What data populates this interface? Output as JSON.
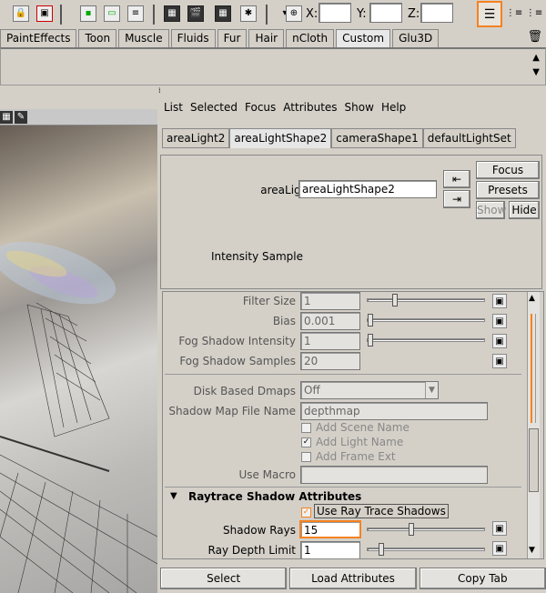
{
  "toolbar": {
    "x_label": "X:",
    "y_label": "Y:",
    "z_label": "Z:",
    "x_value": "",
    "y_value": "",
    "z_value": "",
    "icons": [
      "lock-icon",
      "select-object-icon",
      "snap-icon",
      "render-region-icon",
      "render-icon",
      "render-settings-icon",
      "clapper-icon",
      "ipr-icon",
      "render-view-icon",
      "dropdown-icon",
      "transform-icon",
      "attribute-editor-icon",
      "channel-box-icon",
      "tool-settings-icon"
    ]
  },
  "shelf": {
    "tabs": [
      "PaintEffects",
      "Toon",
      "Muscle",
      "Fluids",
      "Fur",
      "Hair",
      "nCloth",
      "Custom",
      "Glu3D"
    ],
    "active": "Custom"
  },
  "attr_editor": {
    "menu": [
      "List",
      "Selected",
      "Focus",
      "Attributes",
      "Show",
      "Help"
    ],
    "tabs": [
      "areaLight2",
      "areaLightShape2",
      "cameraShape1",
      "defaultLightSet"
    ],
    "active_tab": "areaLightShape2",
    "node_label": "areaLight:",
    "node_value": "areaLightShape2",
    "focus_btn": "Focus",
    "presets_btn": "Presets",
    "show_btn": "Show",
    "hide_btn": "Hide",
    "intensity_sample": "Intensity Sample"
  },
  "attributes": {
    "filter_size_label": "Filter Size",
    "filter_size_value": "1",
    "filter_size_level": 0.22,
    "bias_label": "Bias",
    "bias_value": "0.001",
    "bias_level": 0.0,
    "fog_intensity_label": "Fog Shadow Intensity",
    "fog_intensity_value": "1",
    "fog_intensity_level": 0.0,
    "fog_samples_label": "Fog Shadow Samples",
    "fog_samples_value": "20",
    "disk_dmaps_label": "Disk Based Dmaps",
    "disk_dmaps_value": "Off",
    "shadow_map_label": "Shadow Map File Name",
    "shadow_map_value": "depthmap",
    "add_scene_name": "Add Scene Name",
    "add_light_name": "Add Light Name",
    "add_frame_ext": "Add Frame Ext",
    "use_macro_label": "Use Macro",
    "use_macro_value": "",
    "raytrace_section": "Raytrace Shadow Attributes",
    "use_ray_trace": "Use Ray Trace Shadows",
    "shadow_rays_label": "Shadow Rays",
    "shadow_rays_value": "15",
    "shadow_rays_level": 0.37,
    "ray_depth_label": "Ray Depth Limit",
    "ray_depth_value": "1",
    "ray_depth_level": 0.1
  },
  "bottom": {
    "select": "Select",
    "load_attributes": "Load Attributes",
    "copy_tab": "Copy Tab"
  },
  "colors": {
    "highlight": "#f58220",
    "panel": "#d4d0c8"
  }
}
